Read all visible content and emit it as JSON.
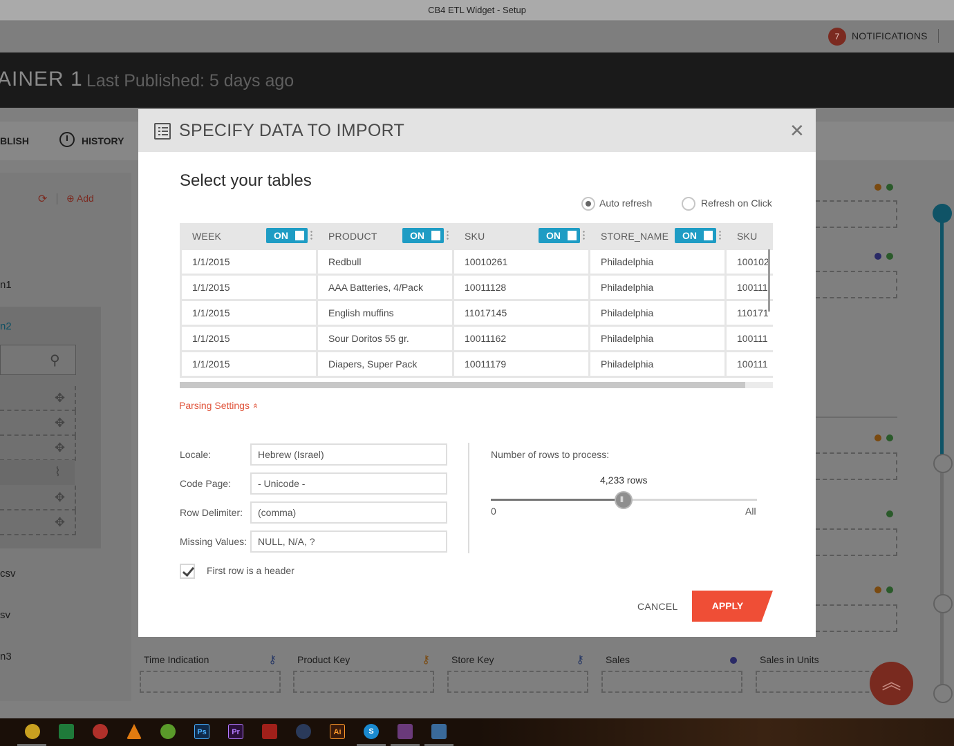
{
  "window": {
    "title": "CB4 ETL Widget - Setup"
  },
  "topnav": {
    "notifications_count": "7",
    "notifications_label": "NOTIFICATIONS"
  },
  "header": {
    "container_name": "AINER 1",
    "last_published": "Last Published: 5 days ago"
  },
  "toolbar": {
    "publish_label": "BLISH",
    "history_label": "HISTORY"
  },
  "left_panel": {
    "add_label": "Add",
    "items": [
      "n1",
      "n2",
      "csv",
      "sv",
      "n3"
    ]
  },
  "bottom_fields": [
    {
      "label": "Time Indication",
      "key_color": "#2a3a66"
    },
    {
      "label": "Product Key",
      "key_color": "#7a4a10"
    },
    {
      "label": "Store Key",
      "key_color": "#2a3a66"
    },
    {
      "label": "Sales",
      "key_color": "#2a3a66"
    },
    {
      "label": "Sales in Units",
      "key_color": "#2a5a2a"
    }
  ],
  "modal": {
    "title": "SPECIFY DATA TO IMPORT",
    "close_symbol": "✕",
    "section_title": "Select your tables",
    "refresh_options": [
      {
        "label": "Auto refresh",
        "checked": true
      },
      {
        "label": "Refresh on Click",
        "checked": false
      }
    ],
    "table": {
      "columns": [
        {
          "name": "WEEK",
          "toggle": "ON"
        },
        {
          "name": "PRODUCT",
          "toggle": "ON"
        },
        {
          "name": "SKU",
          "toggle": "ON"
        },
        {
          "name": "STORE_NAME",
          "toggle": "ON"
        },
        {
          "name": "SKU",
          "toggle": ""
        }
      ],
      "rows": [
        [
          "1/1/2015",
          "Redbull",
          "10010261",
          "Philadelphia",
          "100102"
        ],
        [
          "1/1/2015",
          "AAA Batteries, 4/Pack",
          "10011128",
          "Philadelphia",
          "100111"
        ],
        [
          "1/1/2015",
          "English muffins",
          "11017145",
          "Philadelphia",
          "110171"
        ],
        [
          "1/1/2015",
          "Sour Doritos 55 gr.",
          "10011162",
          "Philadelphia",
          "100111"
        ],
        [
          "1/1/2015",
          "Diapers, Super Pack",
          "10011179",
          "Philadelphia",
          "100111"
        ]
      ]
    },
    "parsing_settings_label": "Parsing Settings",
    "parsing_chevron": "»",
    "fields": [
      {
        "label": "Locale:",
        "value": "Hebrew (Israel)"
      },
      {
        "label": "Code Page:",
        "value": "- Unicode -"
      },
      {
        "label": "Row Delimiter:",
        "value": "(comma)"
      },
      {
        "label": "Missing Values:",
        "value": "NULL, N/A, ?"
      }
    ],
    "rows_to_process": {
      "label": "Number of rows to process:",
      "value_text": "4,233 rows",
      "slider_fraction": 0.5,
      "min_label": "0",
      "max_label": "All"
    },
    "first_row_header": {
      "label": "First row is a header",
      "checked": true
    },
    "cancel_label": "CANCEL",
    "apply_label": "APPLY"
  },
  "colors": {
    "accent_blue": "#1e9cc4",
    "apply_orange": "#ef4e36",
    "link_orange": "#e0533a"
  },
  "taskbar": {
    "apps": [
      "chrome-icon",
      "office-icon",
      "ccleaner-icon",
      "vlc-icon",
      "utorrent-icon",
      "photoshop-icon",
      "premiere-icon",
      "creative-cloud-icon",
      "cinema4d-icon",
      "illustrator-icon",
      "skype-icon",
      "winrar-icon",
      "control-panel-icon"
    ],
    "labels": {
      "photoshop": "Ps",
      "premiere": "Pr",
      "illustrator": "Ai",
      "skype": "S"
    }
  }
}
